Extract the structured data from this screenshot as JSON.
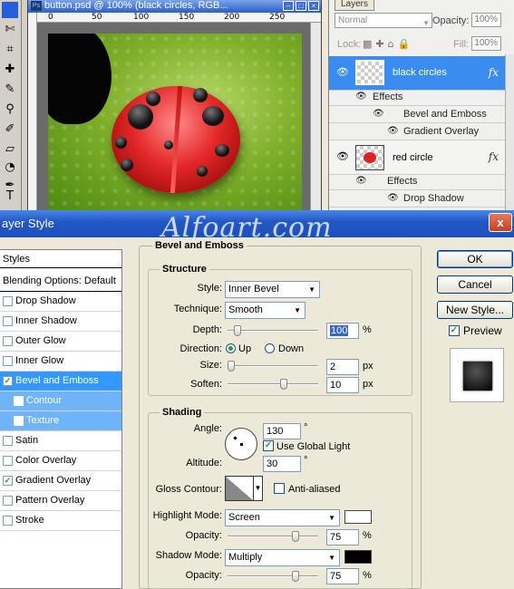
{
  "document": {
    "title": "button.psd @ 100% (black circles, RGB...",
    "ruler_ticks": [
      "0",
      "50",
      "100",
      "150",
      "200",
      "250"
    ]
  },
  "tools": [
    "move",
    "lasso",
    "crop",
    "healing",
    "brush",
    "stamp",
    "history",
    "eraser",
    "gradient",
    "dodge",
    "pen",
    "type"
  ],
  "layers_panel": {
    "tab": "Layers",
    "blend_mode": "Normal",
    "opacity_label": "Opacity:",
    "opacity_value": "100%",
    "lock_label": "Lock:",
    "fill_label": "Fill:",
    "fill_value": "100%",
    "layers": [
      {
        "name": "black circles",
        "selected": true,
        "effects_label": "Effects",
        "effects": [
          "Bevel and Emboss",
          "Gradient Overlay"
        ]
      },
      {
        "name": "red circle",
        "selected": false,
        "effects_label": "Effects",
        "effects": [
          "Drop Shadow"
        ]
      }
    ],
    "fx_label": "fx"
  },
  "watermark": "Alfoart.com",
  "dialog": {
    "title": "ayer Style",
    "close": "x",
    "styles_header": "Styles",
    "blending_options": "Blending Options: Default",
    "styles": [
      {
        "label": "Drop Shadow",
        "checked": false
      },
      {
        "label": "Inner Shadow",
        "checked": false
      },
      {
        "label": "Outer Glow",
        "checked": false
      },
      {
        "label": "Inner Glow",
        "checked": false
      },
      {
        "label": "Bevel and Emboss",
        "checked": true,
        "selected": true
      },
      {
        "label": "Contour",
        "checked": false,
        "sub": true
      },
      {
        "label": "Texture",
        "checked": false,
        "sub": true
      },
      {
        "label": "Satin",
        "checked": false
      },
      {
        "label": "Color Overlay",
        "checked": false
      },
      {
        "label": "Gradient Overlay",
        "checked": true
      },
      {
        "label": "Pattern Overlay",
        "checked": false
      },
      {
        "label": "Stroke",
        "checked": false
      }
    ],
    "section_title": "Bevel and Emboss",
    "structure": {
      "title": "Structure",
      "style_label": "Style:",
      "style_value": "Inner Bevel",
      "technique_label": "Technique:",
      "technique_value": "Smooth",
      "depth_label": "Depth:",
      "depth_value": "100",
      "depth_unit": "%",
      "direction_label": "Direction:",
      "direction_up": "Up",
      "direction_down": "Down",
      "size_label": "Size:",
      "size_value": "2",
      "size_unit": "px",
      "soften_label": "Soften:",
      "soften_value": "10",
      "soften_unit": "px"
    },
    "shading": {
      "title": "Shading",
      "angle_label": "Angle:",
      "angle_value": "130",
      "degree": "°",
      "use_global_light": "Use Global Light",
      "altitude_label": "Altitude:",
      "altitude_value": "30",
      "gloss_contour_label": "Gloss Contour:",
      "anti_aliased": "Anti-aliased",
      "highlight_mode_label": "Highlight Mode:",
      "highlight_mode_value": "Screen",
      "highlight_color": "#ffffff",
      "highlight_opacity_label": "Opacity:",
      "highlight_opacity_value": "75",
      "shadow_mode_label": "Shadow Mode:",
      "shadow_mode_value": "Multiply",
      "shadow_color": "#000000",
      "shadow_opacity_label": "Opacity:",
      "shadow_opacity_value": "75",
      "pct": "%"
    },
    "buttons": {
      "ok": "OK",
      "cancel": "Cancel",
      "new_style": "New Style...",
      "preview": "Preview"
    }
  }
}
